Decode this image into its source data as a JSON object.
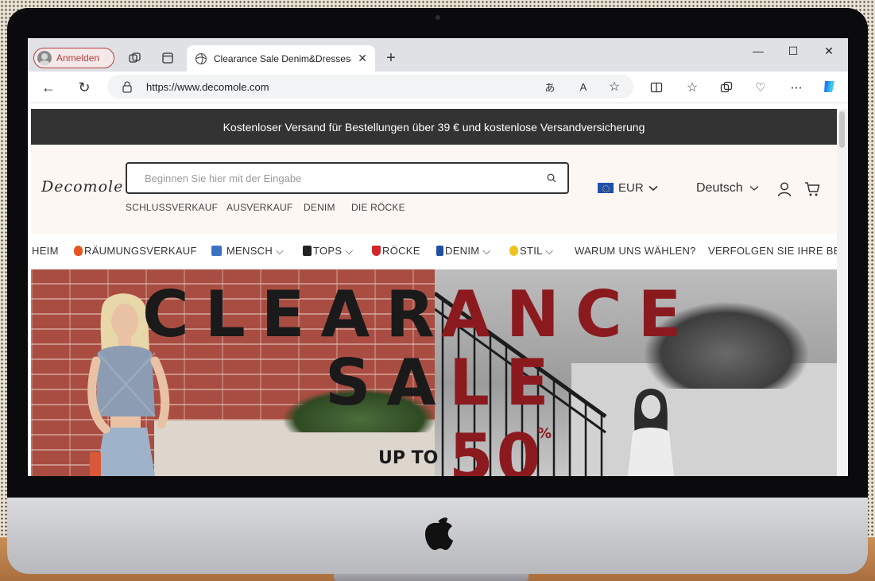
{
  "browser": {
    "signin_label": "Anmelden",
    "tab_title": "Clearance Sale Denim&Dresses&",
    "url": "https://www.decomole.com"
  },
  "site": {
    "announcement": "Kostenloser Versand für Bestellungen über 39 € und kostenlose Versandversicherung",
    "logo": "Decomole",
    "search_placeholder": "Beginnen Sie hier mit der Eingabe",
    "quick_links": [
      "SCHLUSSVERKAUF",
      "AUSVERKAUF",
      "DENIM",
      "DIE RÖCKE"
    ],
    "currency": "EUR",
    "language": "Deutsch",
    "nav": [
      "HEIM",
      "RÄUMUNGSVERKAUF",
      "MENSCH",
      "TOPS",
      "RÖCKE",
      "DENIM",
      "STIL",
      "WARUM UNS WÄHLEN?",
      "VERFOLGEN SIE IHRE BES"
    ]
  },
  "hero": {
    "line1_black": "CLEAR",
    "line1_red": "ANCE",
    "line2_black": "SA",
    "line2_red": "LE",
    "up_to": "UP TO",
    "discount": "50",
    "percent": "%"
  },
  "colors": {
    "accent_red": "#8b1a1f",
    "announcement_bg": "#333333",
    "signin_red": "#b0413e"
  }
}
